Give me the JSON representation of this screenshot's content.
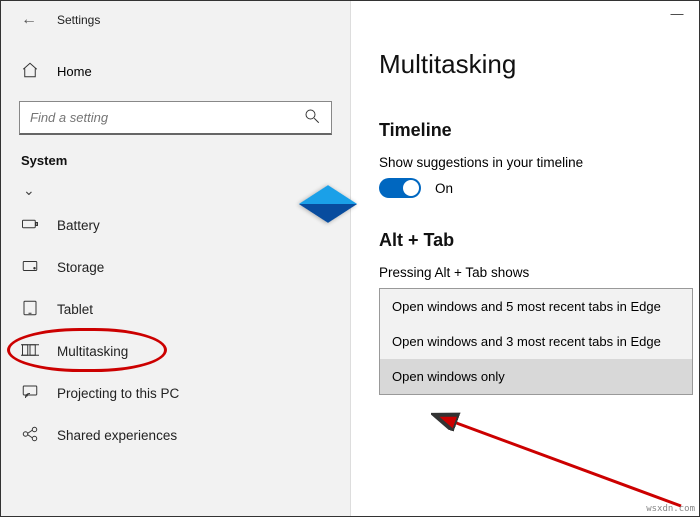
{
  "titlebar": {
    "label": "Settings"
  },
  "home": {
    "label": "Home"
  },
  "search": {
    "placeholder": "Find a setting"
  },
  "section": {
    "label": "System"
  },
  "nav": [
    {
      "id": "truncated",
      "label": " "
    },
    {
      "id": "battery",
      "label": "Battery",
      "icon": "battery-icon"
    },
    {
      "id": "storage",
      "label": "Storage",
      "icon": "storage-icon"
    },
    {
      "id": "tablet",
      "label": "Tablet",
      "icon": "tablet-icon"
    },
    {
      "id": "multitasking",
      "label": "Multitasking",
      "icon": "multitasking-icon",
      "highlight": true
    },
    {
      "id": "projecting",
      "label": "Projecting to this PC",
      "icon": "projecting-icon"
    },
    {
      "id": "shared",
      "label": "Shared experiences",
      "icon": "shared-icon"
    }
  ],
  "page": {
    "title": "Multitasking",
    "timeline": {
      "heading": "Timeline",
      "description": "Show suggestions in your timeline",
      "toggle_label": "On"
    },
    "alttab": {
      "heading": "Alt + Tab",
      "description": "Pressing Alt + Tab shows",
      "options": [
        "Open windows and 5 most recent tabs in Edge",
        "Open windows and 3 most recent tabs in Edge",
        "Open windows only"
      ],
      "selected_index": 2
    }
  },
  "watermark": "wsxdn.com"
}
